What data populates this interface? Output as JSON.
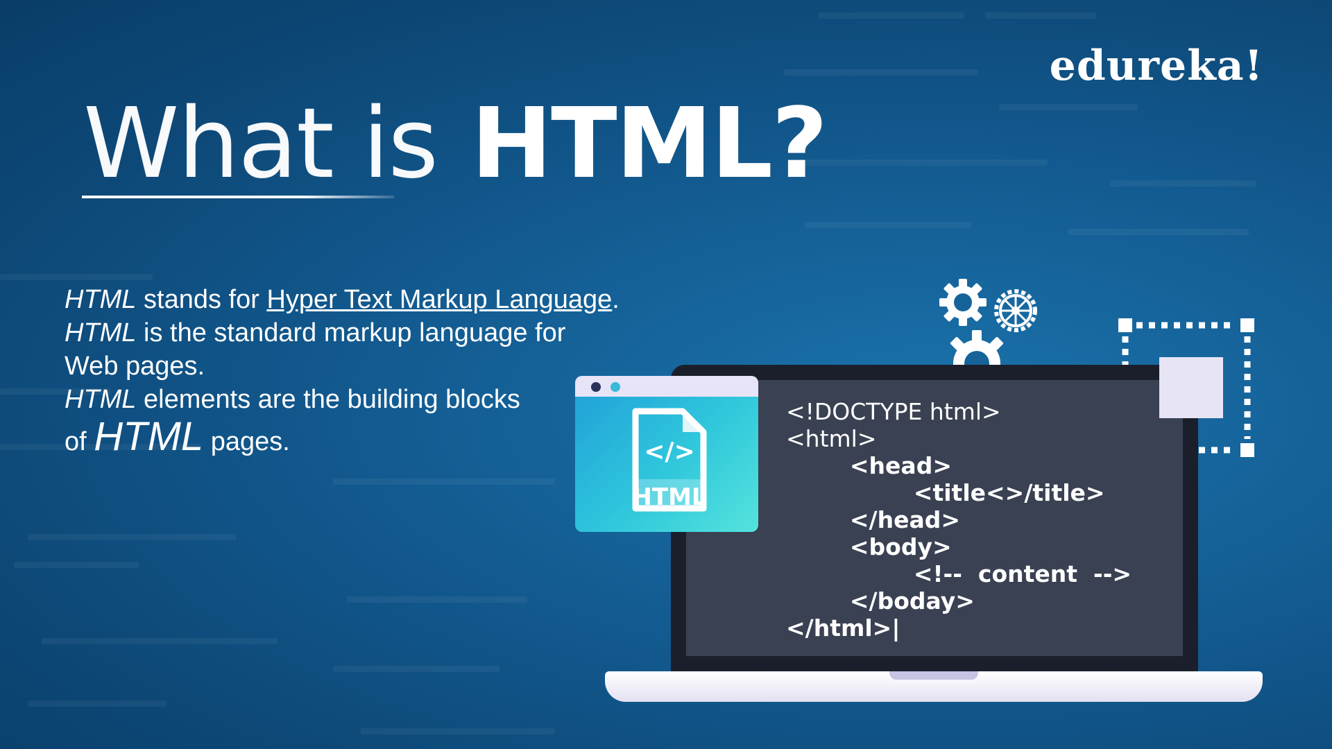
{
  "brand": {
    "name": "edureka!"
  },
  "title": {
    "part1": "What is",
    "part2": "HTML?"
  },
  "description": {
    "line1": {
      "em": "HTML",
      "text": " stands for ",
      "link": "Hyper Text Markup Language",
      "end": "."
    },
    "line2": {
      "em": "HTML",
      "text": " is the standard markup language for"
    },
    "line3": {
      "text": "Web pages."
    },
    "line4": {
      "em": "HTML",
      "text": " elements are the building blocks"
    },
    "line5": {
      "pre": "of ",
      "em": "HTML",
      "text": " pages."
    }
  },
  "browser_file": {
    "tag": "</>",
    "label": "HTML"
  },
  "code_lines": [
    "<!DOCTYPE html>",
    "<html>",
    "        <head>",
    "                <title<>/title>",
    "        </head>",
    "        <body>",
    "                <!--  content  -->",
    "        </boday>",
    "</html>|"
  ],
  "icons": [
    "gear-icon",
    "wheel-gear-icon",
    "selection-frame-icon",
    "html-file-icon"
  ],
  "colors": {
    "background": "#135c92",
    "screen": "#3a4152",
    "accent": "#30c7dc",
    "text": "#ffffff"
  }
}
